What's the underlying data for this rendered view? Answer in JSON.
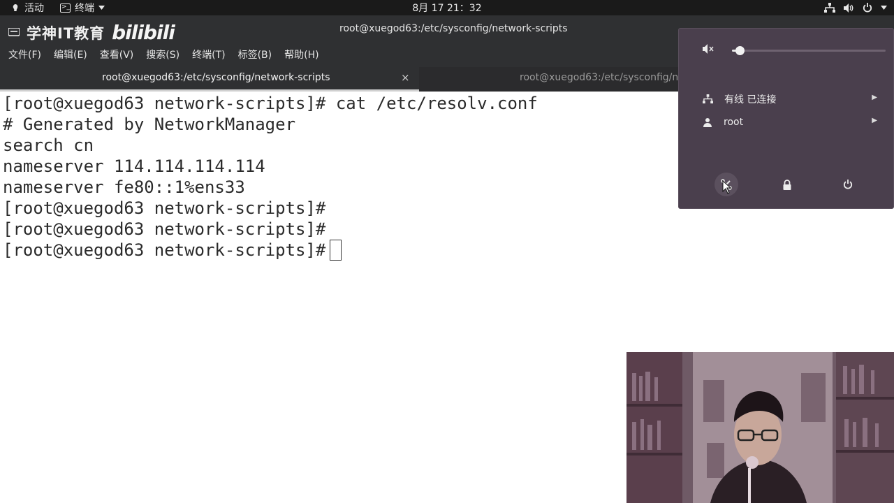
{
  "topbar": {
    "activities": "活动",
    "app_name": "终端",
    "clock": "8月 17  21：32"
  },
  "window": {
    "brand_text": "学神IT教育",
    "brand_logo": "bilibili",
    "title": "root@xuegod63:/etc/sysconfig/network-scripts",
    "menu": [
      "文件(F)",
      "编辑(E)",
      "查看(V)",
      "搜索(S)",
      "终端(T)",
      "标签(B)",
      "帮助(H)"
    ],
    "tabs": [
      {
        "label": "root@xuegod63:/etc/sysconfig/network-scripts",
        "close": "×"
      },
      {
        "label": "root@xuegod63:/etc/sysconfig/network-scripts"
      }
    ]
  },
  "terminal": {
    "lines": [
      "[root@xuegod63 network-scripts]# cat /etc/resolv.conf",
      "# Generated by NetworkManager",
      "search cn",
      "nameserver 114.114.114.114",
      "nameserver fe80::1%ens33",
      "[root@xuegod63 network-scripts]#",
      "[root@xuegod63 network-scripts]#",
      "[root@xuegod63 network-scripts]#"
    ]
  },
  "system_menu": {
    "volume_level": 0.05,
    "items": [
      {
        "label": "有线 已连接",
        "icon": "network-wired-icon"
      },
      {
        "label": "root",
        "icon": "user-icon"
      }
    ],
    "actions": [
      "settings-icon",
      "lock-icon",
      "power-icon"
    ]
  },
  "colors": {
    "topbar_bg": "#1a1a1a",
    "header_bg": "#2f3032",
    "popover_bg": "#4a3f4d",
    "terminal_bg": "#ffffff",
    "terminal_fg": "#2a2a2a"
  }
}
